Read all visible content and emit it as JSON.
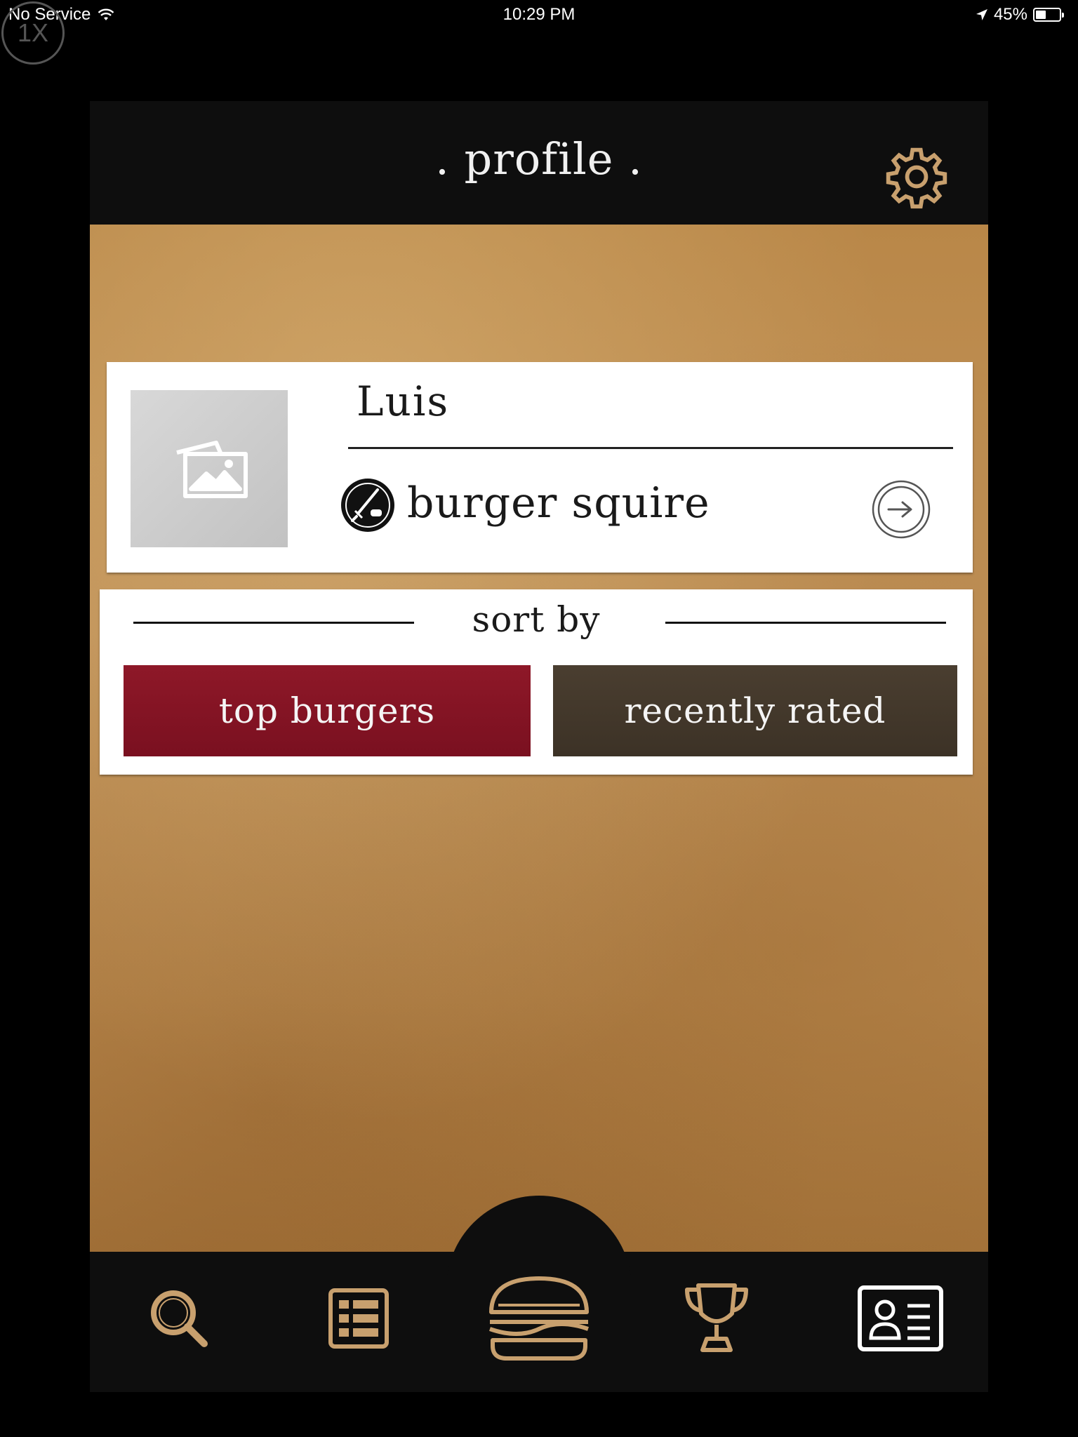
{
  "status_bar": {
    "carrier": "No Service",
    "time": "10:29 PM",
    "battery_percent": "45%",
    "battery_level": 0.45,
    "zoom_badge": "1X"
  },
  "header": {
    "title": ". profile .",
    "settings_icon": "gear-icon"
  },
  "profile": {
    "username": "Luis",
    "rank": "burger squire",
    "rank_icon": "sword-burger-badge-icon",
    "avatar_placeholder_icon": "image-placeholder-icon",
    "go_icon": "arrow-right-circle-icon"
  },
  "sort": {
    "label": "sort by",
    "options": [
      {
        "label": "top burgers",
        "selected": true,
        "color": "#8a1526"
      },
      {
        "label": "recently rated",
        "selected": false,
        "color": "#463a2c"
      }
    ]
  },
  "nav": {
    "items": [
      {
        "icon": "search-icon"
      },
      {
        "icon": "list-icon"
      },
      {
        "icon": "burger-icon"
      },
      {
        "icon": "trophy-icon"
      },
      {
        "icon": "profile-card-icon",
        "active": true
      }
    ],
    "accent_color": "#c8a06e"
  }
}
